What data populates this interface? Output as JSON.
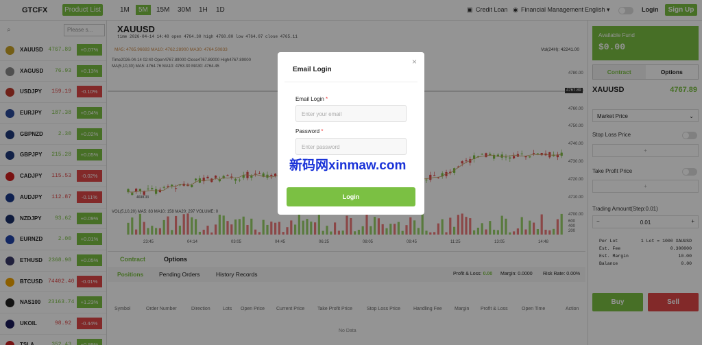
{
  "header": {
    "brand": "GTCFX",
    "product_list": "Product List",
    "timeframes": [
      "1M",
      "5M",
      "15M",
      "30M",
      "1H",
      "1D"
    ],
    "nav": [
      "Credit Loan",
      "Financial Management"
    ],
    "language": "English",
    "login": "Login",
    "signup": "Sign Up"
  },
  "sidebar": {
    "search_placeholder": "Please s...",
    "items": [
      {
        "symbol": "XAUUSD",
        "price": "4767.89",
        "change": "+0.07%",
        "dir": "up"
      },
      {
        "symbol": "XAGUSD",
        "price": "76.93",
        "change": "+0.13%",
        "dir": "up"
      },
      {
        "symbol": "USDJPY",
        "price": "159.19",
        "change": "-0.10%",
        "dir": "down"
      },
      {
        "symbol": "EURJPY",
        "price": "187.38",
        "change": "+0.04%",
        "dir": "up"
      },
      {
        "symbol": "GBPNZD",
        "price": "2.30",
        "change": "+0.02%",
        "dir": "up"
      },
      {
        "symbol": "GBPJPY",
        "price": "215.28",
        "change": "+0.05%",
        "dir": "up"
      },
      {
        "symbol": "CADJPY",
        "price": "115.53",
        "change": "-0.02%",
        "dir": "down"
      },
      {
        "symbol": "AUDJPY",
        "price": "112.87",
        "change": "-0.11%",
        "dir": "down"
      },
      {
        "symbol": "NZDJPY",
        "price": "93.62",
        "change": "+0.09%",
        "dir": "up"
      },
      {
        "symbol": "EURNZD",
        "price": "2.00",
        "change": "+0.01%",
        "dir": "up"
      },
      {
        "symbol": "ETHUSD",
        "price": "2368.98",
        "change": "+0.05%",
        "dir": "up"
      },
      {
        "symbol": "BTCUSD",
        "price": "74402.40",
        "change": "-0.01%",
        "dir": "down"
      },
      {
        "symbol": "NAS100",
        "price": "23163.74",
        "change": "+1.23%",
        "dir": "up"
      },
      {
        "symbol": "UKOIL",
        "price": "98.92",
        "change": "-0.44%",
        "dir": "down"
      },
      {
        "symbol": "TSLA",
        "price": "352.43",
        "change": "+0.99%",
        "dir": "up"
      }
    ]
  },
  "chart_area": {
    "symbol": "XAUUSD",
    "ohlc": "time 2026-04-14 14:48   open 4764.30   high 4768.80   low 4764.07   close 4765.11",
    "ma_line": "MA5: 4765.96693   MA10: 4762.28900   MA30: 4764.50833",
    "vol_label": "Vol(24H): 42241.00",
    "info1": "Time2026-04-14 02:40  Open4767.89000  Close4767.89000  High4767.89000",
    "info2": "MA(5,10,30)  MA5: 4764.76  MA10: 4763.30  MA30: 4764.45",
    "price_ticks": [
      "4780.00",
      "4770.00",
      "4760.00",
      "4750.00",
      "4740.00",
      "4730.00",
      "4720.00",
      "4710.00",
      "4700.00"
    ],
    "current_price": "4767.89",
    "low_marker": "4698.33",
    "vol_info": "VOL(5,10,20)  MA5: 83  MA10: 158  MA20: 297  VOLUME: 0",
    "vol_ticks": [
      "600",
      "400",
      "200"
    ],
    "time_ticks": [
      "23:45",
      "04:14",
      "03:05",
      "04:45",
      "06:25",
      "08:05",
      "09:45",
      "11:25",
      "13:05",
      "14:48"
    ]
  },
  "bottom": {
    "tabs": [
      "Contract",
      "Options"
    ],
    "subtabs": [
      "Positions",
      "Pending Orders",
      "History Records"
    ],
    "pl_label": "Profit & Loss:",
    "pl_value": "0.00",
    "margin_text": "Margin: 0.0000",
    "risk_text": "Risk Rate: 0.00%",
    "columns": [
      "Symbol",
      "Order Number",
      "Direction",
      "Lots",
      "Open Price",
      "Current Price",
      "Take Profit Price",
      "Stop Loss Price",
      "Handling Fee",
      "Margin",
      "Profit & Loss",
      "Open Time",
      "Action"
    ],
    "empty": "No Data"
  },
  "panel": {
    "fund_label": "Available Fund",
    "fund_value": "$0.00",
    "tabs": [
      "Contract",
      "Options"
    ],
    "symbol": "XAUUSD",
    "price": "4767.89",
    "order_type": "Market Price",
    "stop_loss": "Stop Loss Price",
    "take_profit": "Take Profit Price",
    "amount_label": "Trading Amount(Step:0.01)",
    "amount_value": "0.01",
    "info": [
      [
        "Per Lot",
        "1 Lot = 1000 XAUUSD"
      ],
      [
        "Est. Fee",
        "0.300000"
      ],
      [
        "Est. Margin",
        "10.00"
      ],
      [
        "Balance",
        "0.00"
      ]
    ],
    "buy": "Buy",
    "sell": "Sell"
  },
  "modal": {
    "title": "Email Login",
    "email_label": "Email Login",
    "email_placeholder": "Enter your email",
    "password_label": "Password",
    "password_placeholder": "Enter password",
    "submit": "Login"
  },
  "watermark": "新码网xinmaw.com",
  "colors": {
    "up": "#7bc043",
    "down": "#e04848",
    "accent": "#7bc043"
  }
}
